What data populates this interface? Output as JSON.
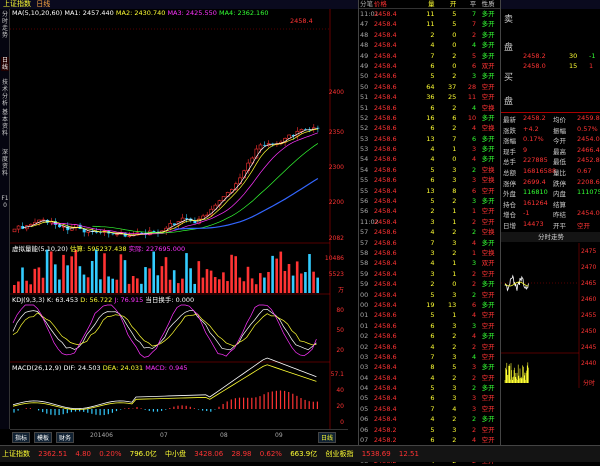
{
  "title": {
    "sym": "上证指数",
    "period": "日线"
  },
  "ma_line": {
    "name": "MA(5,10,20,60)",
    "ma1": "MA1: 2457.440",
    "ma2": "MA2: 2430.740",
    "ma3": "MA3: 2425.550",
    "ma4": "MA4: 2362.160"
  },
  "price_axis": [
    "2458",
    "2400",
    "2350",
    "2300",
    "2250",
    "2200",
    "2150",
    "2100",
    "2082"
  ],
  "top_annot": {
    "high": "2458.4",
    "low": "2082"
  },
  "vol_info": {
    "name": "虚拟量能(5,10,20)",
    "v1": "估算: 595237.438",
    "v2": "实际: 227695.000"
  },
  "vol_axis": [
    "10486",
    "5523",
    "万"
  ],
  "kdj_info": {
    "name": "KDJ(9,3,3)",
    "k": "K: 63.453",
    "d": "D: 56.722",
    "j": "J: 76.915",
    "extra": "当日换手: 0.000"
  },
  "kdj_axis": [
    "80",
    "50",
    "20"
  ],
  "macd_info": {
    "name": "MACD(26,12,9)",
    "dif": "DIF: 24.503",
    "dea": "DEA: 24.031",
    "macd": "MACD: 0.945"
  },
  "macd_axis": [
    "57.1",
    "40",
    "20",
    "0",
    "-20"
  ],
  "dates": [
    "201406",
    "07",
    "08",
    "09"
  ],
  "bottom_tabs": [
    "指标",
    "模板",
    "财务",
    "日线"
  ],
  "sidebar_tabs": [
    "分时走势",
    "日线",
    "技术分析",
    "基本资料",
    "深度资料",
    "F10"
  ],
  "tick_header": [
    "分笔",
    "价格",
    "量",
    "开",
    "平",
    "性质",
    "线"
  ],
  "ticks": [
    [
      "11:01",
      "2458.4",
      "11",
      "5",
      "7",
      "多开"
    ],
    [
      "47",
      "2458.4",
      "11",
      "5",
      "7",
      "多开"
    ],
    [
      "48",
      "2458.4",
      "2",
      "0",
      "2",
      "多开"
    ],
    [
      "48",
      "2458.4",
      "4",
      "0",
      "4",
      "多开"
    ],
    [
      "49",
      "2458.4",
      "7",
      "2",
      "5",
      "多开"
    ],
    [
      "49",
      "2458.4",
      "6",
      "0",
      "6",
      "双开"
    ],
    [
      "50",
      "2458.6",
      "5",
      "2",
      "3",
      "多开"
    ],
    [
      "50",
      "2458.6",
      "64",
      "37",
      "28",
      "空开"
    ],
    [
      "51",
      "2458.4",
      "36",
      "25",
      "11",
      "空开"
    ],
    [
      "51",
      "2458.6",
      "6",
      "2",
      "4",
      "空换"
    ],
    [
      "52",
      "2458.6",
      "16",
      "6",
      "10",
      "多开"
    ],
    [
      "52",
      "2458.6",
      "6",
      "2",
      "4",
      "空换"
    ],
    [
      "53",
      "2458.6",
      "13",
      "7",
      "6",
      "多开"
    ],
    [
      "53",
      "2458.6",
      "4",
      "1",
      "3",
      "多开"
    ],
    [
      "54",
      "2458.6",
      "4",
      "0",
      "4",
      "多开"
    ],
    [
      "54",
      "2458.6",
      "5",
      "3",
      "2",
      "空换"
    ],
    [
      "55",
      "2458.6",
      "6",
      "3",
      "3",
      "空换"
    ],
    [
      "55",
      "2458.4",
      "13",
      "8",
      "6",
      "空开"
    ],
    [
      "56",
      "2458.4",
      "5",
      "2",
      "3",
      "多开"
    ],
    [
      "56",
      "2458.4",
      "2",
      "1",
      "1",
      "空开"
    ],
    [
      "11:02",
      "2458.4",
      "3",
      "1",
      "2",
      "空开"
    ],
    [
      "57",
      "2458.6",
      "4",
      "2",
      "2",
      "空换"
    ],
    [
      "57",
      "2458.6",
      "7",
      "3",
      "4",
      "多开"
    ],
    [
      "58",
      "2458.6",
      "3",
      "2",
      "1",
      "空换"
    ],
    [
      "58",
      "2458.4",
      "4",
      "1",
      "3",
      "双开"
    ],
    [
      "59",
      "2458.4",
      "3",
      "1",
      "2",
      "空开"
    ],
    [
      "59",
      "2458.4",
      "2",
      "0",
      "2",
      "多开"
    ],
    [
      "00",
      "2458.4",
      "5",
      "3",
      "2",
      "空开"
    ],
    [
      "00",
      "2458.4",
      "19",
      "13",
      "6",
      "多开"
    ],
    [
      "01",
      "2458.6",
      "5",
      "1",
      "4",
      "空开"
    ],
    [
      "01",
      "2458.6",
      "6",
      "3",
      "3",
      "空开"
    ],
    [
      "02",
      "2458.6",
      "6",
      "2",
      "4",
      "多开"
    ],
    [
      "02",
      "2458.6",
      "4",
      "2",
      "2",
      "空开"
    ],
    [
      "03",
      "2458.6",
      "7",
      "3",
      "4",
      "空开"
    ],
    [
      "03",
      "2458.4",
      "8",
      "5",
      "3",
      "多开"
    ],
    [
      "04",
      "2458.4",
      "4",
      "2",
      "2",
      "空开"
    ],
    [
      "04",
      "2458.4",
      "5",
      "3",
      "2",
      "多开"
    ],
    [
      "05",
      "2458.4",
      "6",
      "3",
      "3",
      "空开"
    ],
    [
      "05",
      "2458.4",
      "7",
      "4",
      "3",
      "空开"
    ],
    [
      "06",
      "2458.4",
      "4",
      "2",
      "2",
      "多开"
    ],
    [
      "06",
      "2458.2",
      "5",
      "3",
      "2",
      "空开"
    ],
    [
      "07",
      "2458.2",
      "6",
      "2",
      "4",
      "空开"
    ],
    [
      "07",
      "2458.2",
      "49",
      "43",
      "6",
      "多开"
    ],
    [
      "08",
      "2458.2",
      "4",
      "2",
      "2",
      "空开"
    ]
  ],
  "quote": {
    "sell_lbl": "卖",
    "buy_lbl": "买",
    "pan_lbl": "盘",
    "sell_price": "2458.2",
    "sell_vol": "30",
    "sell_chg": "-1",
    "buy_price": "2458.0",
    "buy_vol": "15",
    "buy_chg": "1",
    "rows": [
      [
        "最新",
        "2458.2",
        "均价",
        "2459.8"
      ],
      [
        "涨跌",
        "+4.2",
        "振幅",
        "0.57%"
      ],
      [
        "涨幅",
        "0.17%",
        "今开",
        "2454.0"
      ],
      [
        "现手",
        "9",
        "最高",
        "2466.4"
      ],
      [
        "总手",
        "227885",
        "最低",
        "2452.8"
      ],
      [
        "总额",
        "16816588",
        "量比",
        "0.67"
      ],
      [
        "涨停",
        "2699.4",
        "跌停",
        "2208.6"
      ],
      [
        "外盘",
        "116810",
        "内盘",
        "111075"
      ],
      [
        "持仓",
        "161264",
        "结算",
        ""
      ],
      [
        "增仓",
        "-1",
        "昨结",
        "2454.0"
      ],
      [
        "日增",
        "14473",
        "开平",
        "空开"
      ]
    ],
    "mini_title": "分时走势",
    "mini_axis": [
      "2475",
      "2470",
      "2465",
      "2460",
      "2455",
      "2450",
      "2445",
      "2440"
    ],
    "mini_vol": "分时"
  },
  "status": {
    "index_name": "上证指数",
    "index_val": "2362.51",
    "index_chg": "4.80",
    "index_pct": "0.20%",
    "amt": "796.0亿",
    "b2_name": "中小盘",
    "b2_val": "3428.06",
    "b2_chg": "28.98",
    "b2_pct": "0.62%",
    "b2_amt": "663.9亿",
    "b3_name": "创业板指",
    "b3_val": "1538.69",
    "b3_chg": "12.51"
  }
}
